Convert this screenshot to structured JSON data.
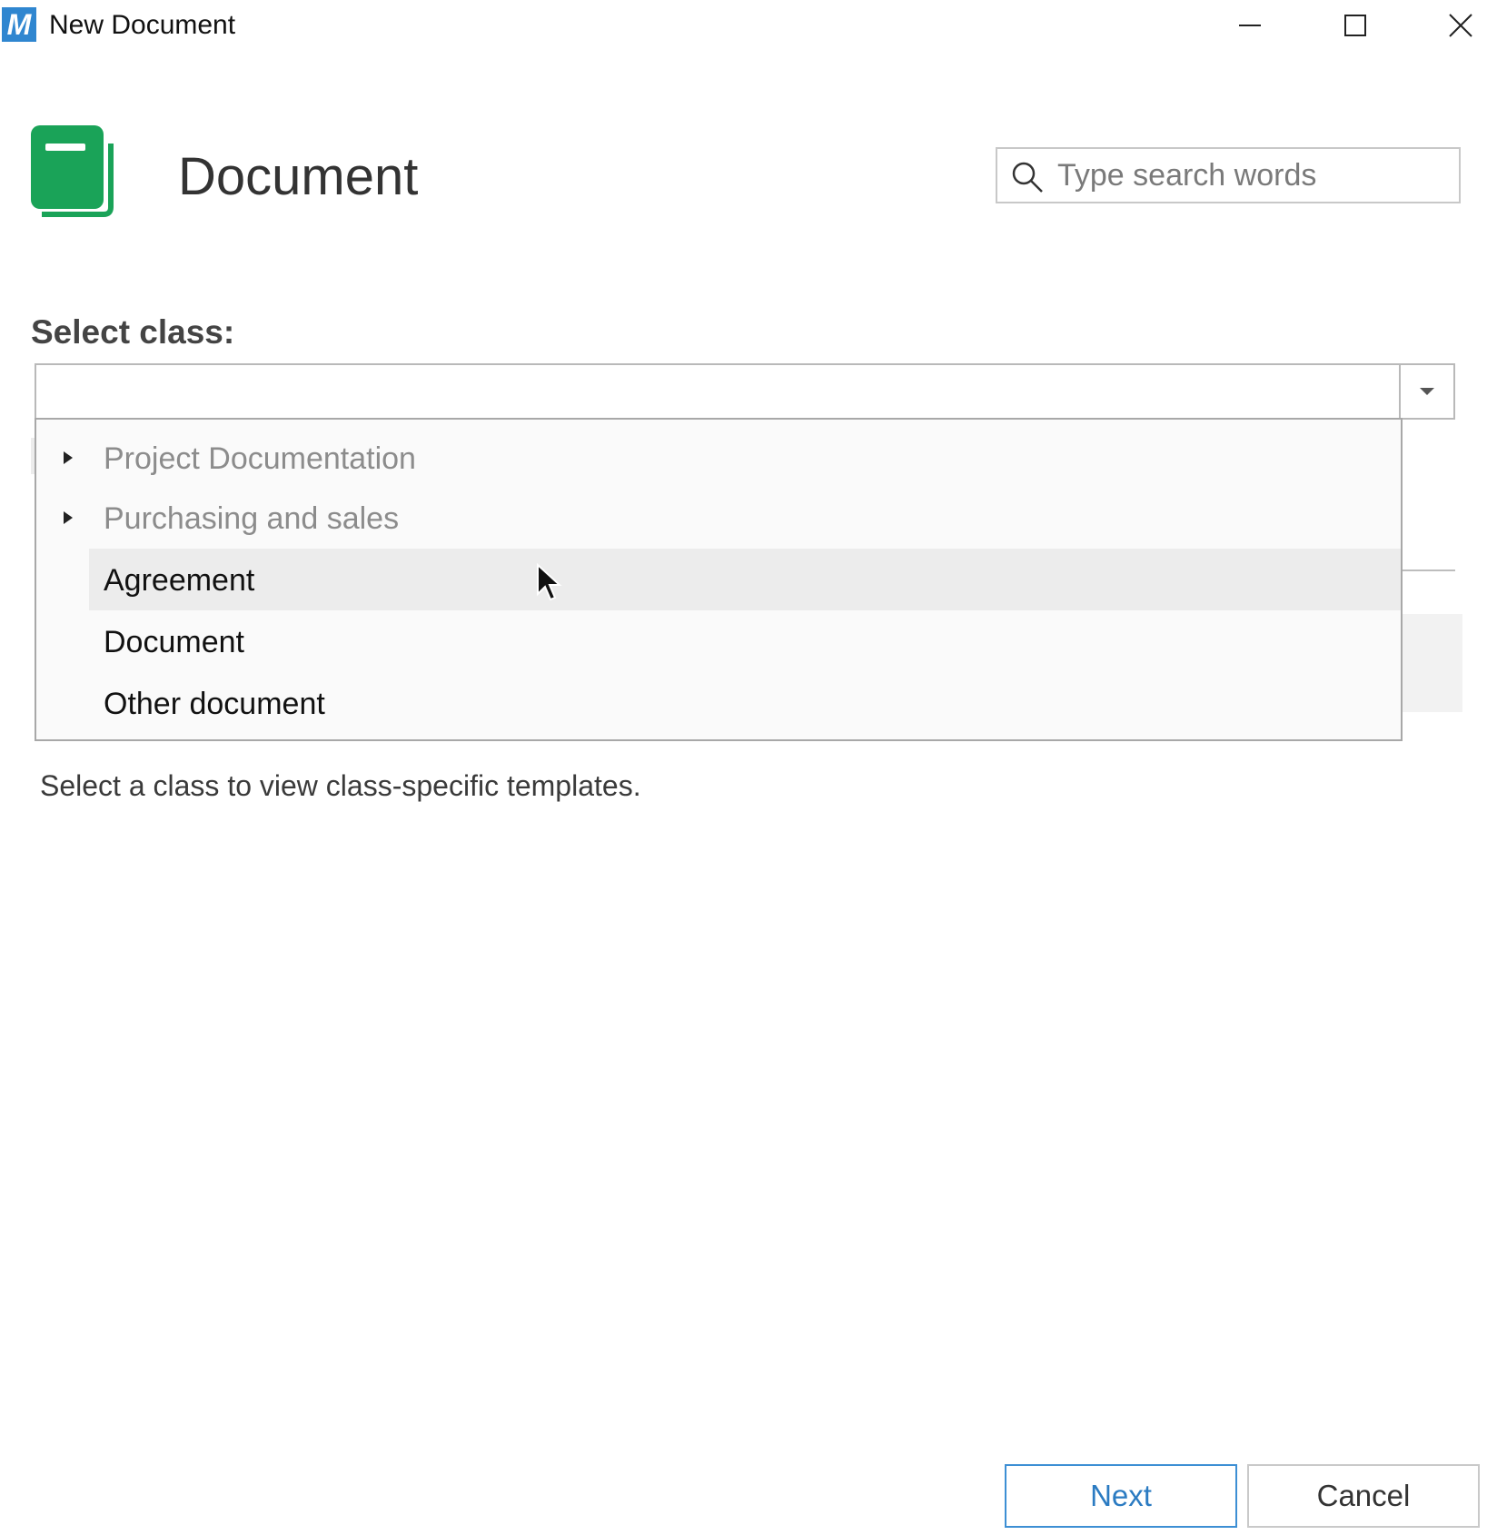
{
  "window": {
    "app_logo_letter": "M",
    "title": "New Document",
    "controls": [
      "minimize",
      "maximize",
      "close"
    ]
  },
  "header": {
    "icon": "document-book-icon",
    "title": "Document",
    "search": {
      "placeholder": "Type search words",
      "value": ""
    }
  },
  "select_class": {
    "label": "Select class:",
    "value": "",
    "options": [
      {
        "label": "Project Documentation",
        "expandable": true,
        "muted": true
      },
      {
        "label": "Purchasing and sales",
        "expandable": true,
        "muted": true
      },
      {
        "label": "Agreement",
        "expandable": false,
        "muted": false,
        "hovered": true
      },
      {
        "label": "Document",
        "expandable": false,
        "muted": false
      },
      {
        "label": "Other document",
        "expandable": false,
        "muted": false
      }
    ]
  },
  "help_text": "Select a class to view class-specific templates.",
  "buttons": {
    "next": "Next",
    "cancel": "Cancel"
  },
  "colors": {
    "accent": "#2b7bc2",
    "doc_icon_green": "#1aa358",
    "logo_blue": "#2f86d0"
  }
}
